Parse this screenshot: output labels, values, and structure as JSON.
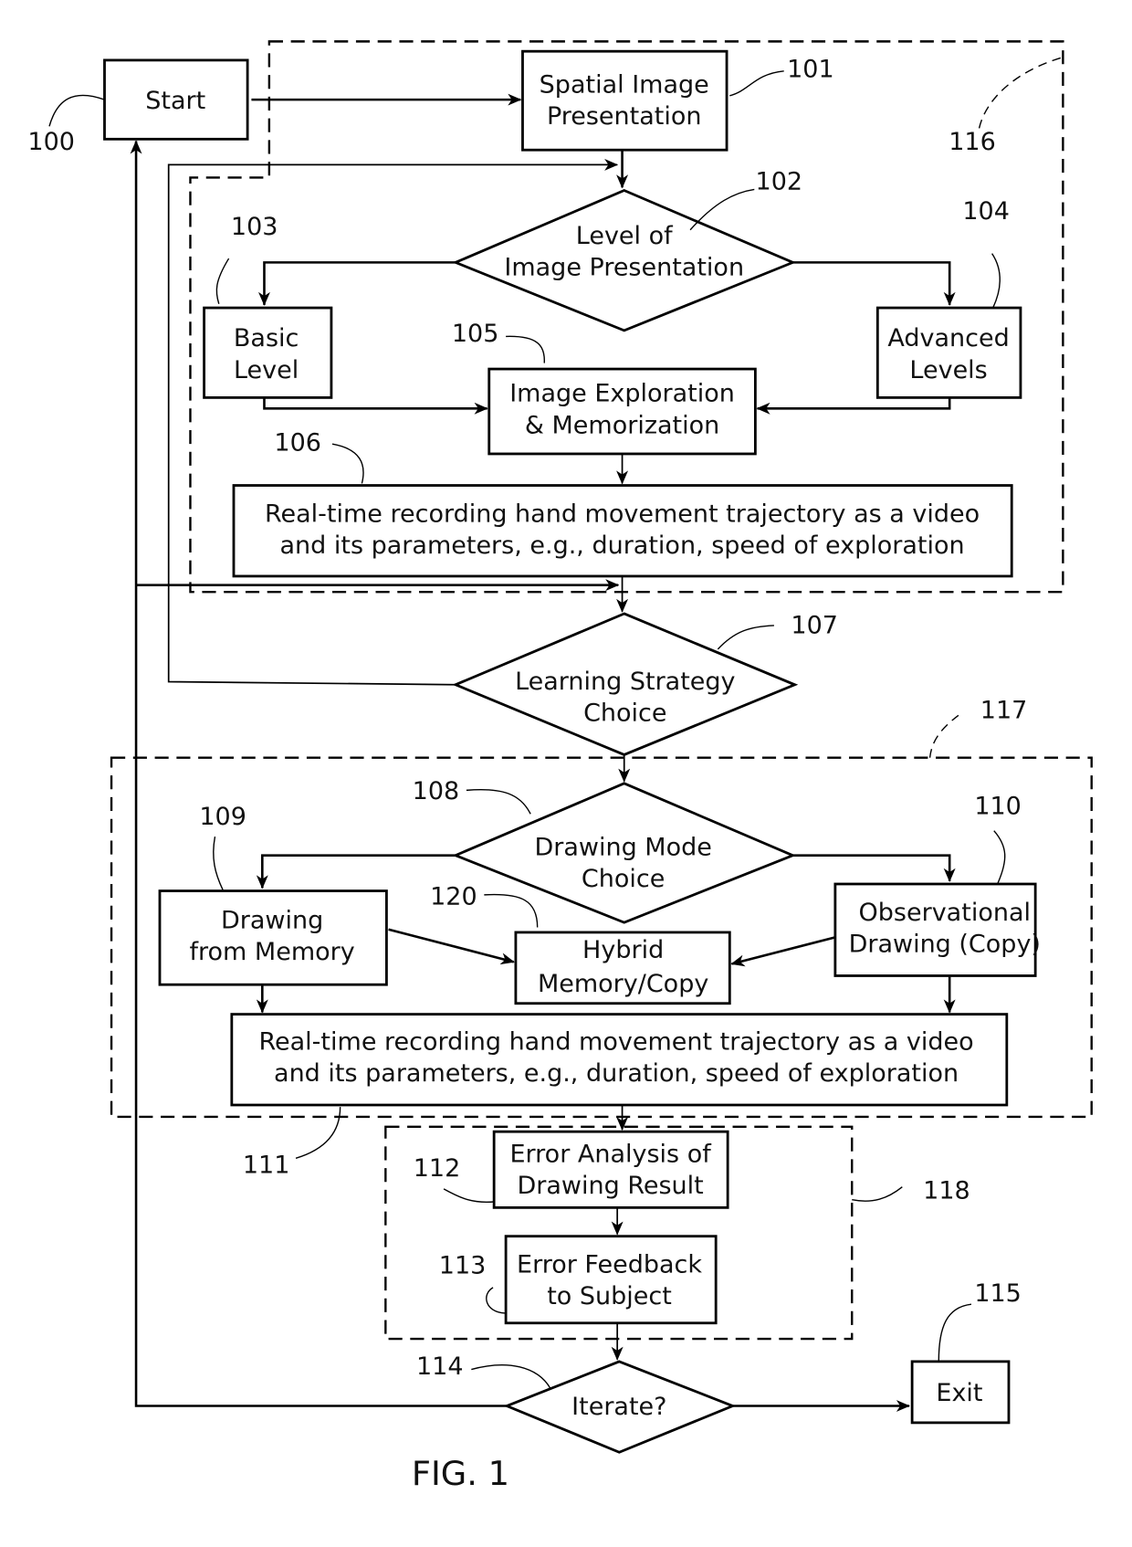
{
  "figure": {
    "caption": "FIG. 1",
    "stroke_color": "#000000",
    "background": "#ffffff"
  },
  "nodes": {
    "start": {
      "ref": "100",
      "lines": [
        "Start"
      ],
      "shape": "box"
    },
    "spatial_image_presentation": {
      "ref": "101",
      "lines": [
        "Spatial Image",
        "Presentation"
      ],
      "shape": "box"
    },
    "level_of_image_presentation": {
      "ref": "102",
      "lines": [
        "Level of",
        "Image Presentation"
      ],
      "shape": "diamond"
    },
    "basic_level": {
      "ref": "103",
      "lines": [
        "Basic",
        "Level"
      ],
      "shape": "box"
    },
    "advanced_levels": {
      "ref": "104",
      "lines": [
        "Advanced",
        "Levels"
      ],
      "shape": "box"
    },
    "image_exploration": {
      "ref": "105",
      "lines": [
        "Image Exploration",
        "& Memorization"
      ],
      "shape": "box"
    },
    "recording_exploration": {
      "ref": "106",
      "lines": [
        "Real-time recording hand movement trajectory as a video",
        "and its parameters, e.g., duration, speed of exploration"
      ],
      "shape": "box"
    },
    "learning_strategy_choice": {
      "ref": "107",
      "lines": [
        "Learning Strategy",
        "Choice"
      ],
      "shape": "diamond"
    },
    "drawing_mode_choice": {
      "ref": "108",
      "lines": [
        "Drawing Mode",
        "Choice"
      ],
      "shape": "diamond"
    },
    "drawing_from_memory": {
      "ref": "109",
      "lines": [
        "Drawing",
        "from Memory"
      ],
      "shape": "box"
    },
    "observational_drawing": {
      "ref": "110",
      "lines": [
        "Observational",
        "Drawing (Copy)"
      ],
      "shape": "box"
    },
    "recording_drawing": {
      "ref": "111",
      "lines": [
        "Real-time recording hand movement trajectory as a video",
        "and its parameters, e.g., duration, speed of exploration"
      ],
      "shape": "box"
    },
    "error_analysis": {
      "ref": "112",
      "lines": [
        "Error Analysis of",
        "Drawing Result"
      ],
      "shape": "box"
    },
    "error_feedback": {
      "ref": "113",
      "lines": [
        "Error Feedback",
        "to Subject"
      ],
      "shape": "box"
    },
    "iterate": {
      "ref": "114",
      "lines": [
        "Iterate?"
      ],
      "shape": "diamond"
    },
    "exit": {
      "ref": "115",
      "lines": [
        "Exit"
      ],
      "shape": "box"
    },
    "hybrid": {
      "ref": "120",
      "lines": [
        "Hybrid",
        "Memory/Copy"
      ],
      "shape": "box"
    }
  },
  "groups": {
    "presentation_group": {
      "ref": "116"
    },
    "drawing_group": {
      "ref": "117"
    },
    "feedback_group": {
      "ref": "118"
    }
  },
  "edges": [
    {
      "from": "start",
      "to": "spatial_image_presentation"
    },
    {
      "from": "spatial_image_presentation",
      "to": "level_of_image_presentation"
    },
    {
      "from": "level_of_image_presentation",
      "to": "basic_level"
    },
    {
      "from": "level_of_image_presentation",
      "to": "advanced_levels"
    },
    {
      "from": "basic_level",
      "to": "image_exploration"
    },
    {
      "from": "advanced_levels",
      "to": "image_exploration"
    },
    {
      "from": "image_exploration",
      "to": "recording_exploration"
    },
    {
      "from": "recording_exploration",
      "to": "learning_strategy_choice"
    },
    {
      "from": "learning_strategy_choice",
      "to": "level_of_image_presentation"
    },
    {
      "from": "learning_strategy_choice",
      "to": "drawing_mode_choice"
    },
    {
      "from": "drawing_mode_choice",
      "to": "drawing_from_memory"
    },
    {
      "from": "drawing_mode_choice",
      "to": "observational_drawing"
    },
    {
      "from": "drawing_from_memory",
      "to": "hybrid"
    },
    {
      "from": "observational_drawing",
      "to": "hybrid"
    },
    {
      "from": "drawing_from_memory",
      "to": "recording_drawing"
    },
    {
      "from": "observational_drawing",
      "to": "recording_drawing"
    },
    {
      "from": "recording_drawing",
      "to": "error_analysis"
    },
    {
      "from": "error_analysis",
      "to": "error_feedback"
    },
    {
      "from": "error_feedback",
      "to": "iterate"
    },
    {
      "from": "iterate",
      "to": "exit"
    },
    {
      "from": "iterate",
      "to": "start"
    },
    {
      "from": "iterate",
      "to": "learning_strategy_choice"
    }
  ]
}
